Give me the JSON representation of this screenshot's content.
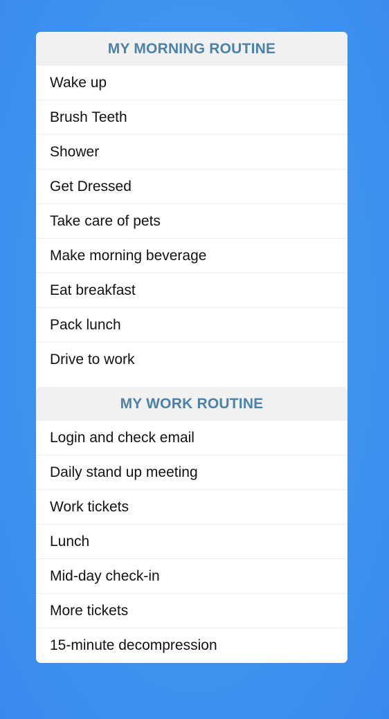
{
  "sections": [
    {
      "title": "MY MORNING ROUTINE",
      "items": [
        "Wake up",
        "Brush Teeth",
        "Shower",
        "Get Dressed",
        "Take care of pets",
        "Make morning beverage",
        "Eat breakfast",
        "Pack lunch",
        "Drive to work"
      ]
    },
    {
      "title": "MY WORK ROUTINE",
      "items": [
        "Login and check email",
        "Daily stand up meeting",
        "Work tickets",
        "Lunch",
        "Mid-day check-in",
        "More tickets",
        "15-minute decompression"
      ]
    }
  ],
  "colors": {
    "background": "#3f96ee",
    "header_text": "#4a82a8",
    "header_bg": "#f1f1f1"
  }
}
